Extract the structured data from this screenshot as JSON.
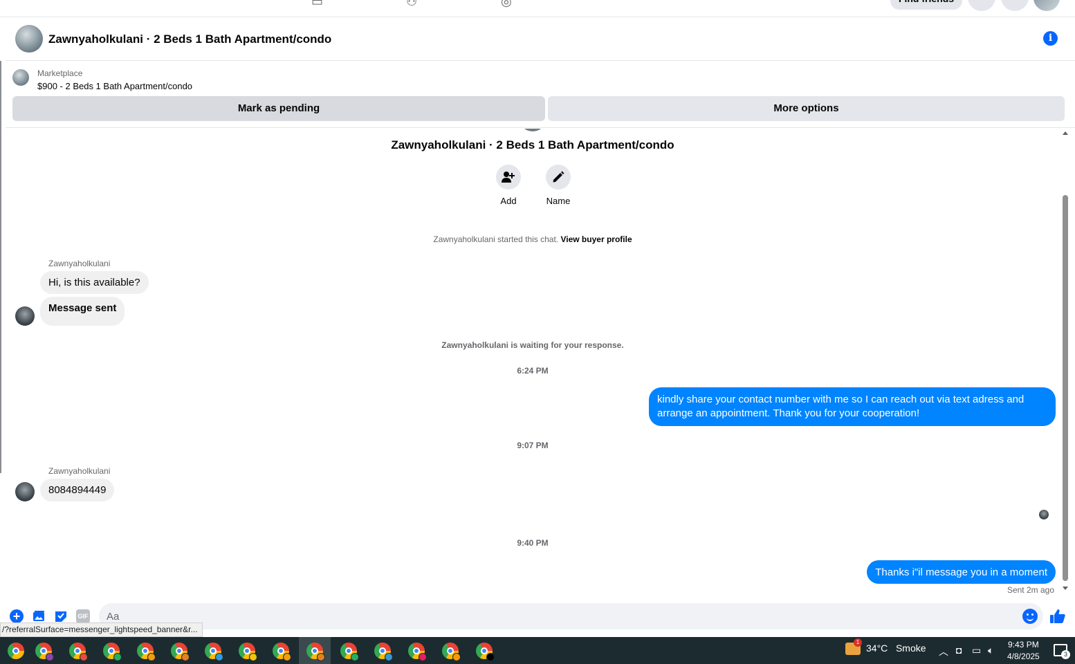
{
  "topnav": {
    "find_friends_label": "Find friends"
  },
  "header": {
    "title": "Zawnyaholkulani · 2 Beds 1 Bath Apartment/condo"
  },
  "marketplace": {
    "label": "Marketplace",
    "listing": "$900 - 2 Beds 1 Bath Apartment/condo",
    "mark_pending_label": "Mark as pending",
    "more_options_label": "More options"
  },
  "chat": {
    "title": "Zawnyaholkulani · 2 Beds 1 Bath Apartment/condo",
    "actions": {
      "add_label": "Add",
      "name_label": "Name"
    },
    "started_text": "Zawnyaholkulani started this chat.",
    "view_profile_link": "View buyer profile",
    "messages": [
      {
        "sender": "Zawnyaholkulani",
        "text": "Hi, is this available?"
      },
      {
        "text": "Message sent"
      }
    ],
    "waiting_text": "Zawnyaholkulani is waiting for your response.",
    "time_1": "6:24 PM",
    "outgoing_1": "kindly share your contact number with me so I can reach out via text adress and arrange an appointment. Thank you for your cooperation!",
    "time_2": "9:07 PM",
    "incoming_2_sender": "Zawnyaholkulani",
    "incoming_2_text": "8084894449",
    "time_3": "9:40 PM",
    "outgoing_2": "Thanks i\"il message you in a moment",
    "sent_status": "Sent 2m ago"
  },
  "composer": {
    "placeholder": "Aa",
    "gif_label": "GIF"
  },
  "status_url": "/?referralSurface=messenger_lightspeed_banner&r...",
  "taskbar": {
    "weather_temp": "34°C",
    "weather_desc": "Smoke",
    "weather_badge": "1",
    "time": "9:43 PM",
    "date": "4/8/2025",
    "notification_count": "3",
    "profile_dot_colors": [
      "#8e44ad",
      "#8e44ad",
      "#e74c3c",
      "#27ae60",
      "#f39c12",
      "#e67e22",
      "#3498db",
      "#f1c40f",
      "#f39c12",
      "#e67e22",
      "#27ae60",
      "#3498db",
      "#e91e63",
      "#ff9800",
      "#000000"
    ]
  },
  "colors": {
    "accent": "#0866ff",
    "bubble_out": "#0084ff",
    "bubble_in": "#f0f0f0",
    "taskbar": "#1c2b30"
  }
}
